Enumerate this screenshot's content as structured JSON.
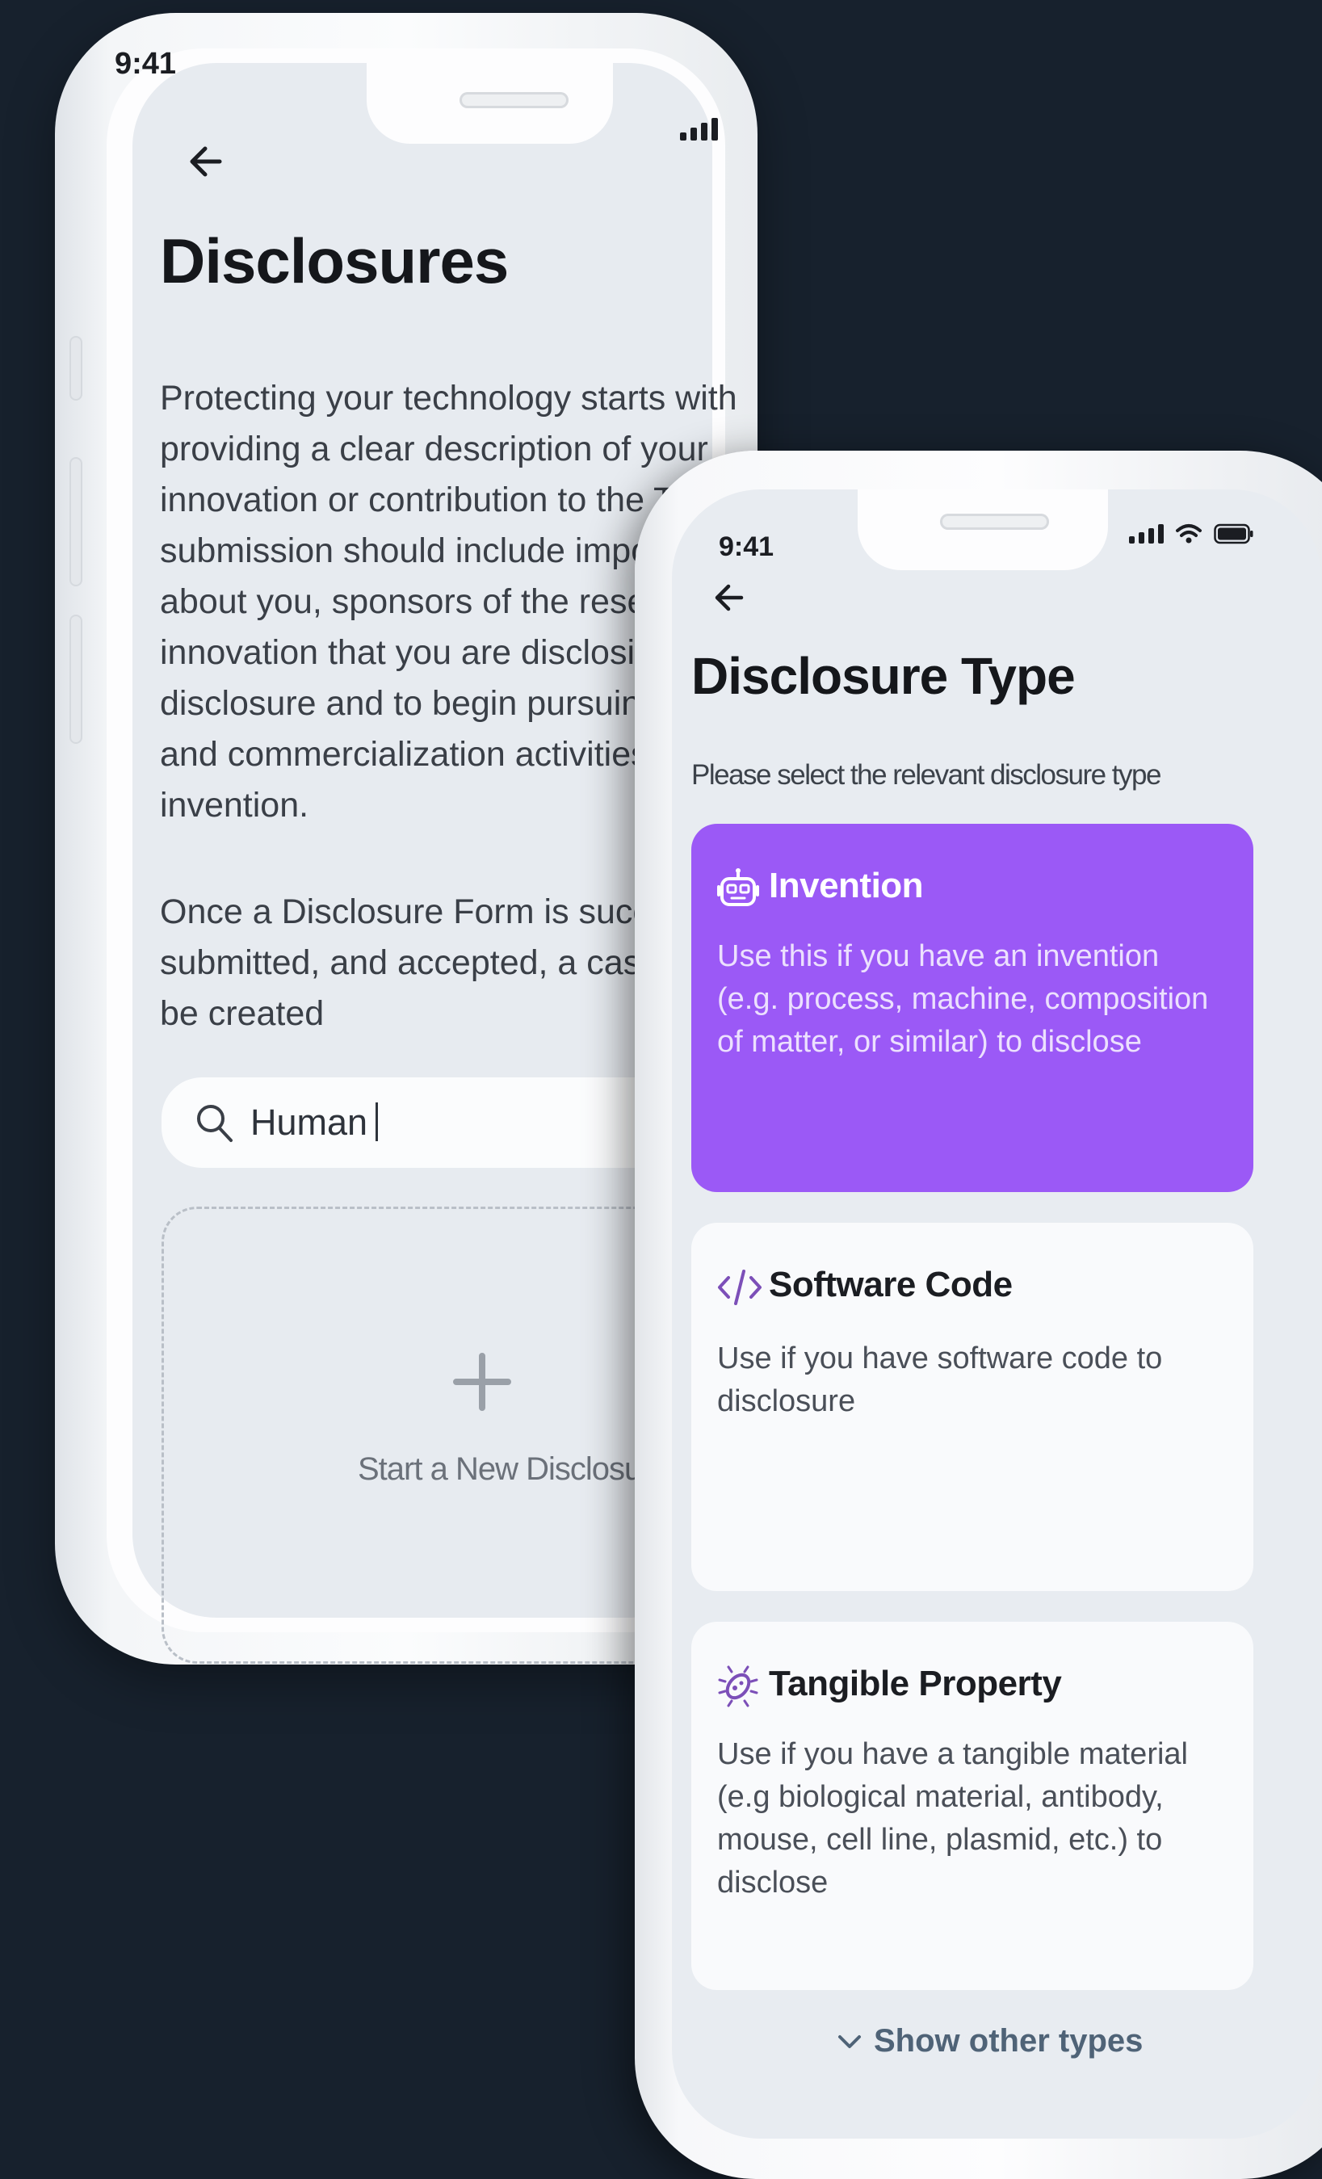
{
  "phone1": {
    "status_time": "9:41",
    "title": "Disclosures",
    "description_p1": "Protecting your technology starts with\nproviding a clear description of your\ninnovation or contribution to the T\nsubmission should include impor\nabout you, sponsors of the resea\ninnovation that you are disclosin\ndisclosure and to begin pursuing\nand commercialization activities\ninvention.",
    "description_p2": "Once a Disclosure Form is succe\nsubmitted, and accepted, a case\nbe created",
    "search": {
      "value": "Human",
      "icon": "search-icon"
    },
    "new_disclosure_label": "Start a New Disclosure"
  },
  "phone2": {
    "status_time": "9:41",
    "title": "Disclosure Type",
    "subtitle": "Please select the relevant disclosure type",
    "cards": [
      {
        "title": "Invention",
        "description": "Use this if you have an invention (e.g. process, machine, composition of matter, or similar) to disclose",
        "icon": "robot-icon",
        "selected": true
      },
      {
        "title": "Software Code",
        "description": "Use if you have software code to disclosure",
        "icon": "code-icon",
        "selected": false
      },
      {
        "title": "Tangible Property",
        "description": "Use if you have a tangible material (e.g biological material, antibody, mouse, cell line, plasmid, etc.) to disclose",
        "icon": "molecule-icon",
        "selected": false
      }
    ],
    "show_more_label": "Show other types"
  },
  "colors": {
    "background": "#17212d",
    "accent": "#9b59f6",
    "screen": "#e8ecf1",
    "link": "#4f6377"
  }
}
